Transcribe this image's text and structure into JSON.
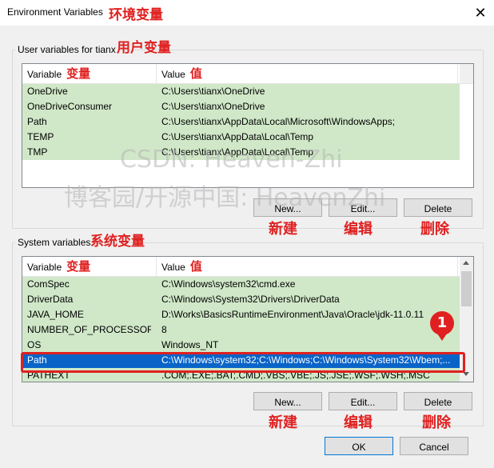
{
  "window": {
    "title": "Environment Variables",
    "title_annotation": "环境变量",
    "close_glyph": "✕"
  },
  "user_group": {
    "label": "User variables for tianx",
    "annotation": "用户变量",
    "columns": {
      "variable": "Variable",
      "variable_anno": "变量",
      "value": "Value",
      "value_anno": "值"
    },
    "rows": [
      {
        "name": "OneDrive",
        "value": "C:\\Users\\tianx\\OneDrive"
      },
      {
        "name": "OneDriveConsumer",
        "value": "C:\\Users\\tianx\\OneDrive"
      },
      {
        "name": "Path",
        "value": "C:\\Users\\tianx\\AppData\\Local\\Microsoft\\WindowsApps;"
      },
      {
        "name": "TEMP",
        "value": "C:\\Users\\tianx\\AppData\\Local\\Temp"
      },
      {
        "name": "TMP",
        "value": "C:\\Users\\tianx\\AppData\\Local\\Temp"
      }
    ],
    "buttons": {
      "new": "New...",
      "edit": "Edit...",
      "delete": "Delete"
    },
    "button_annos": {
      "new": "新建",
      "edit": "编辑",
      "delete": "删除"
    }
  },
  "system_group": {
    "label": "System variables",
    "annotation": "系统变量",
    "columns": {
      "variable": "Variable",
      "variable_anno": "变量",
      "value": "Value",
      "value_anno": "值"
    },
    "rows": [
      {
        "name": "ComSpec",
        "value": "C:\\Windows\\system32\\cmd.exe"
      },
      {
        "name": "DriverData",
        "value": "C:\\Windows\\System32\\Drivers\\DriverData"
      },
      {
        "name": "JAVA_HOME",
        "value": "D:\\Works\\BasicsRuntimeEnvironment\\Java\\Oracle\\jdk-11.0.11"
      },
      {
        "name": "NUMBER_OF_PROCESSORS",
        "value": "8"
      },
      {
        "name": "OS",
        "value": "Windows_NT"
      },
      {
        "name": "Path",
        "value": "C:\\Windows\\system32;C:\\Windows;C:\\Windows\\System32\\Wbem;..."
      },
      {
        "name": "PATHEXT",
        "value": ".COM;.EXE;.BAT;.CMD;.VBS;.VBE;.JS;.JSE;.WSF;.WSH;.MSC"
      }
    ],
    "selected_row": "Path",
    "buttons": {
      "new": "New...",
      "edit": "Edit...",
      "delete": "Delete"
    },
    "button_annos": {
      "new": "新建",
      "edit": "编辑",
      "delete": "删除"
    }
  },
  "watermark": {
    "line1": "CSDN: Heaven-Zhi",
    "line2": "博客园/开源中国: HeavenZhi"
  },
  "callout": {
    "number": "1"
  },
  "footer": {
    "ok": "OK",
    "cancel": "Cancel"
  },
  "colors": {
    "row_bg": "#d0e8c8",
    "selection": "#0a64c8",
    "annotation": "#e02020"
  }
}
